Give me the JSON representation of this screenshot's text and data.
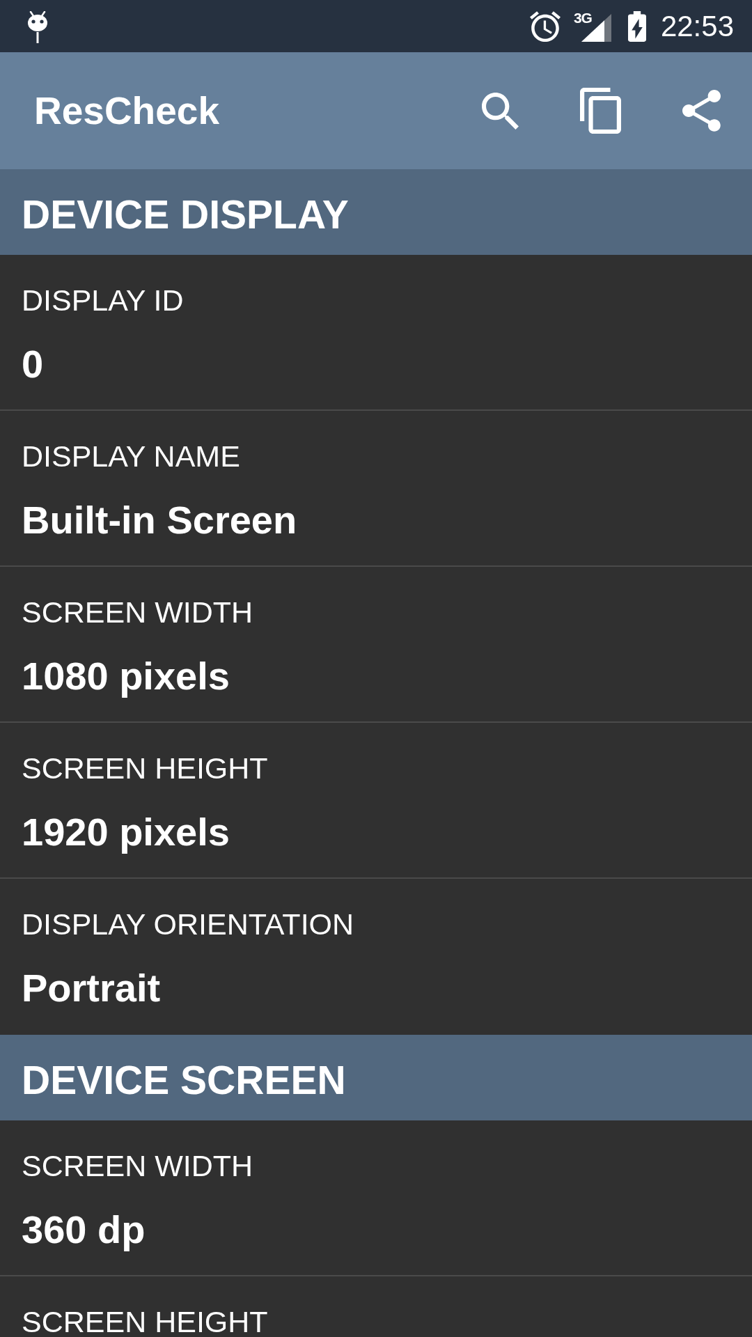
{
  "status_bar": {
    "network": "3G",
    "time": "22:53"
  },
  "app_bar": {
    "title": "ResCheck"
  },
  "sections": [
    {
      "title": "DEVICE DISPLAY",
      "items": [
        {
          "label": "DISPLAY ID",
          "value": "0"
        },
        {
          "label": "DISPLAY NAME",
          "value": "Built-in Screen"
        },
        {
          "label": "SCREEN WIDTH",
          "value": "1080 pixels"
        },
        {
          "label": "SCREEN HEIGHT",
          "value": "1920 pixels"
        },
        {
          "label": "DISPLAY ORIENTATION",
          "value": "Portrait"
        }
      ]
    },
    {
      "title": "DEVICE SCREEN",
      "items": [
        {
          "label": "SCREEN WIDTH",
          "value": "360 dp"
        },
        {
          "label": "SCREEN HEIGHT"
        }
      ]
    }
  ]
}
